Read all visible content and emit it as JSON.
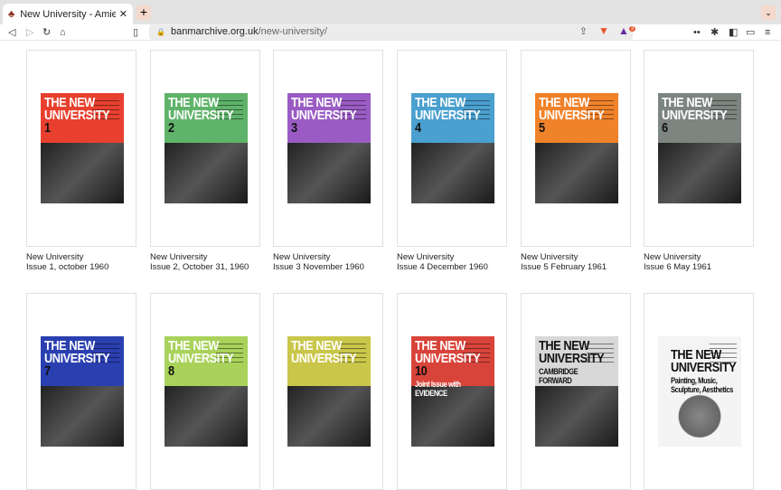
{
  "browser": {
    "tab_title": "New University - Amiel Melburn",
    "url_domain": "banmarchive.org.uk",
    "url_path": "/new-university/",
    "brave_badge": "3"
  },
  "issues": [
    {
      "name": "New University",
      "issue": "Issue 1, october 1960",
      "number": "1",
      "color": "#e8402f"
    },
    {
      "name": "New University",
      "issue": "Issue 2, October 31, 1960",
      "number": "2",
      "color": "#5fb36a"
    },
    {
      "name": "New University",
      "issue": "Issue 3 November 1960",
      "number": "3",
      "color": "#9a5cc4"
    },
    {
      "name": "New University",
      "issue": "Issue 4 December 1960",
      "number": "4",
      "color": "#4aa0cf"
    },
    {
      "name": "New University",
      "issue": "Issue 5 February 1961",
      "number": "5",
      "color": "#f0822a"
    },
    {
      "name": "New University",
      "issue": "Issue 6 May 1961",
      "number": "6",
      "color": "#7d8580"
    },
    {
      "number": "7",
      "color": "#2a3fb0"
    },
    {
      "number": "8",
      "color": "#a8d25a"
    },
    {
      "number": "",
      "color": "#c9c64a"
    },
    {
      "number": "10",
      "color": "#d9443a",
      "subtitle": "Joint Issue with EVIDENCE"
    },
    {
      "number": "",
      "color": "#d8d8d8",
      "subtitle": "CAMBRIDGE FORWARD"
    },
    {
      "number": "",
      "color": "#f4f4f4",
      "subtitle": "Painting, Music, Sculpture, Aesthetics"
    }
  ],
  "cover_title": "THE NEW UNIVERSITY"
}
